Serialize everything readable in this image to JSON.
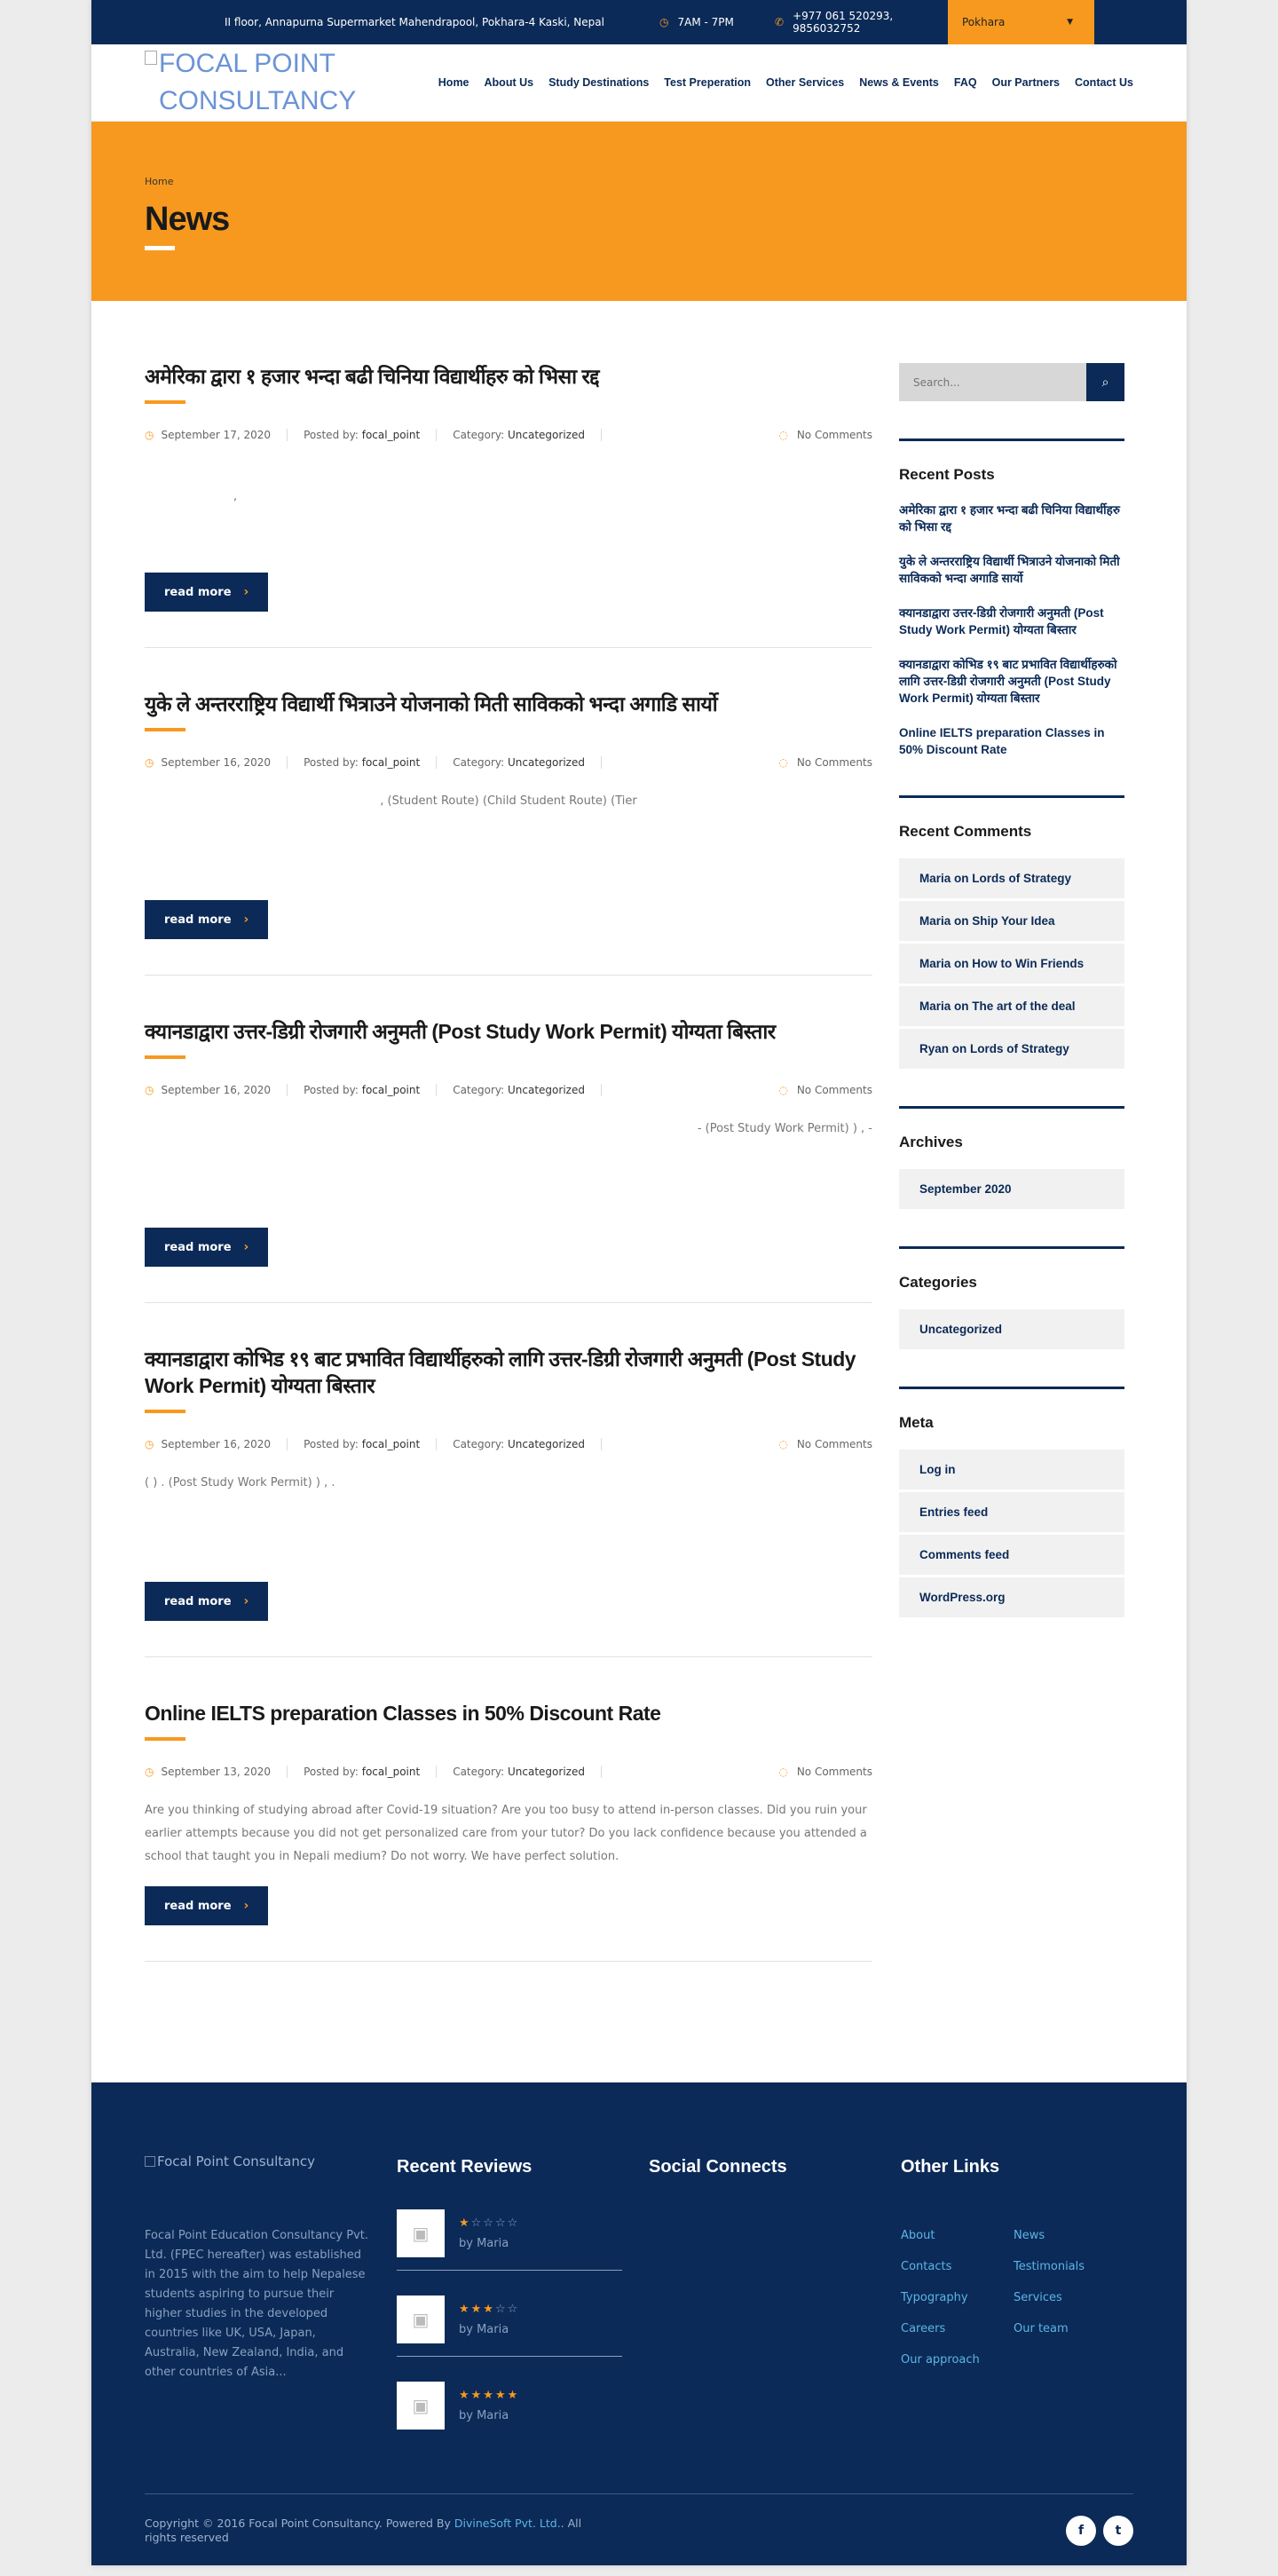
{
  "topbar": {
    "address": "II floor, Annapurna Supermarket Mahendrapool, Pokhara-4 Kaski, Nepal",
    "hours": "7AM - 7PM",
    "phone": "+977 061 520293, 9856032752",
    "branch": "Pokhara"
  },
  "header": {
    "logo_alt": "FOCAL POINT CONSULTANCY",
    "nav": [
      "Home",
      "About Us",
      "Study Destinations",
      "Test Preperation",
      "Other Services",
      "News & Events",
      "FAQ",
      "Our Partners",
      "Contact Us"
    ]
  },
  "banner": {
    "crumb": "Home",
    "title": "News"
  },
  "posts": [
    {
      "title": "अमेरिका द्वारा १ हजार भन्दा बढी चिनिया विद्यार्थीहरु को भिसा रद्द",
      "date": "September 17, 2020",
      "posted_by_label": "Posted by:",
      "author": "focal_point",
      "category_label": "Category:",
      "category": "Uncategorized",
      "comments": "No Comments",
      "excerpt": ",",
      "read_more": "read more"
    },
    {
      "title": "युके ले अन्तरराष्ट्रिय विद्यार्थी भित्राउने योजनाको मिती साविकको भन्दा अगाडि सार्यो",
      "date": "September 16, 2020",
      "posted_by_label": "Posted by:",
      "author": "focal_point",
      "category_label": "Category:",
      "category": "Uncategorized",
      "comments": "No Comments",
      "excerpt": ",  (Student Route)  (Child Student Route)  (Tier",
      "read_more": "read more"
    },
    {
      "title": "क्यानडाद्वारा उत्तर-डिग्री रोजगारी अनुमती (Post Study Work Permit) योग्यता बिस्तार",
      "date": "September 16, 2020",
      "posted_by_label": "Posted by:",
      "author": "focal_point",
      "category_label": "Category:",
      "category": "Uncategorized",
      "comments": "No Comments",
      "excerpt": "-  (Post Study Work Permit)  ) ,  -",
      "read_more": "read more"
    },
    {
      "title": "क्यानडाद्वारा कोभिड १९ बाट प्रभावित विद्यार्थीहरुको लागि उत्तर-डिग्री रोजगारी अनुमती (Post Study Work Permit) योग्यता बिस्तार",
      "date": "September 16, 2020",
      "posted_by_label": "Posted by:",
      "author": "focal_point",
      "category_label": "Category:",
      "category": "Uncategorized",
      "comments": "No Comments",
      "excerpt": "(  )  .  (Post Study Work Permit)  ) ,  .",
      "read_more": "read more"
    },
    {
      "title": "Online IELTS preparation Classes in 50% Discount Rate",
      "date": "September 13, 2020",
      "posted_by_label": "Posted by:",
      "author": "focal_point",
      "category_label": "Category:",
      "category": "Uncategorized",
      "comments": "No Comments",
      "excerpt": "Are you thinking of studying abroad after Covid-19 situation? Are you too busy to attend in-person classes. Did you ruin your earlier attempts because you did not get personalized care from your tutor? Do you lack confidence because you attended a school that taught you in Nepali medium? Do not worry. We have perfect solution.",
      "read_more": "read more"
    }
  ],
  "sidebar": {
    "search_placeholder": "Search...",
    "recent_posts_title": "Recent Posts",
    "recent_posts": [
      "अमेरिका द्वारा १ हजार भन्दा बढी चिनिया विद्यार्थीहरु को भिसा रद्द",
      "युके ले अन्तरराष्ट्रिय विद्यार्थी भित्राउने योजनाको मिती साविकको भन्दा अगाडि सार्यो",
      "क्यानडाद्वारा उत्तर-डिग्री रोजगारी अनुमती (Post Study Work Permit) योग्यता बिस्तार",
      "क्यानडाद्वारा कोभिड १९ बाट प्रभावित विद्यार्थीहरुको लागि उत्तर-डिग्री रोजगारी अनुमती (Post Study Work Permit) योग्यता बिस्तार",
      "Online IELTS preparation Classes in 50% Discount Rate"
    ],
    "recent_comments_title": "Recent Comments",
    "recent_comments": [
      "Maria on Lords of Strategy",
      "Maria on Ship Your Idea",
      "Maria on How to Win Friends",
      "Maria on The art of the deal",
      "Ryan on Lords of Strategy"
    ],
    "archives_title": "Archives",
    "archives": [
      "September 2020"
    ],
    "categories_title": "Categories",
    "categories": [
      "Uncategorized"
    ],
    "meta_title": "Meta",
    "meta": [
      "Log in",
      "Entries feed",
      "Comments feed",
      "WordPress.org"
    ]
  },
  "footer": {
    "logo_alt": "Focal Point Consultancy",
    "about": "Focal Point Education Consultancy Pvt. Ltd. (FPEC hereafter) was established in 2015 with the aim to help Nepalese students aspiring to pursue their higher studies in the developed countries like UK, USA, Japan, Australia, New Zealand, India, and other countries of Asia...",
    "reviews_title": "Recent Reviews",
    "reviews": [
      {
        "rating": 1,
        "by": "by Maria"
      },
      {
        "rating": 3,
        "by": "by Maria"
      },
      {
        "rating": 5,
        "by": "by Maria"
      }
    ],
    "social_title": "Social Connects",
    "links_title": "Other Links",
    "links": [
      "About",
      "News",
      "Contacts",
      "Testimonials",
      "Typography",
      "Services",
      "Careers",
      "Our team",
      "Our approach"
    ],
    "copyright_pre": "Copyright © 2016 Focal Point Consultancy. Powered By",
    "copyright_link": "DivineSoft Pvt. Ltd.",
    "copyright_post": ". All rights reserved",
    "social_icons": [
      "facebook-icon",
      "twitter-icon"
    ]
  },
  "colors": {
    "navy": "#0b2a57",
    "orange": "#f7991f",
    "link_blue": "#5cb4e6"
  }
}
